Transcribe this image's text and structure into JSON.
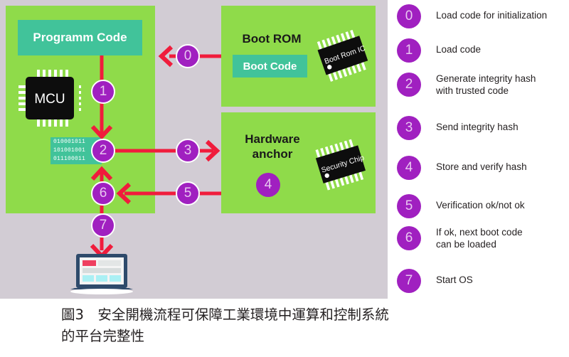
{
  "diagram": {
    "left_panel": {
      "program_code_label": "Programm Code",
      "mcu_label": "MCU",
      "binary_lines": [
        "010001011",
        "101001001",
        "011100011"
      ]
    },
    "boot_rom_panel": {
      "title": "Boot ROM",
      "boot_code_label": "Boot Code",
      "chip_label": "Boot Rom IC"
    },
    "hardware_anchor_panel": {
      "title_line1": "Hardware",
      "title_line2": "anchor",
      "chip_label": "Security Chip",
      "step_number": "4"
    },
    "flow_numbers": {
      "n0": "0",
      "n1": "1",
      "n2": "2",
      "n3": "3",
      "n5": "5",
      "n6": "6",
      "n7": "7"
    },
    "colors": {
      "canvas_bg": "#d2ccd4",
      "panel_green": "#8fdb4a",
      "block_teal": "#41c39a",
      "circle_purple": "#a020c0",
      "arrow_red": "#f01c3c",
      "chip_black": "#111111",
      "laptop_navy": "#2e4a6b"
    }
  },
  "legend": {
    "items": [
      {
        "number": "0",
        "text": "Load code for initialization"
      },
      {
        "number": "1",
        "text": "Load code"
      },
      {
        "number": "2",
        "text": "Generate integrity hash\nwith trusted code"
      },
      {
        "number": "3",
        "text": "Send integrity hash"
      },
      {
        "number": "4",
        "text": "Store and verify hash"
      },
      {
        "number": "5",
        "text": "Verification ok/not ok"
      },
      {
        "number": "6",
        "text": "If ok, next boot code\ncan be loaded"
      },
      {
        "number": "7",
        "text": "Start OS"
      }
    ]
  },
  "caption": {
    "line1": "圖3　安全開機流程可保障工業環境中運算和控制系統",
    "line2": "的平台完整性"
  }
}
